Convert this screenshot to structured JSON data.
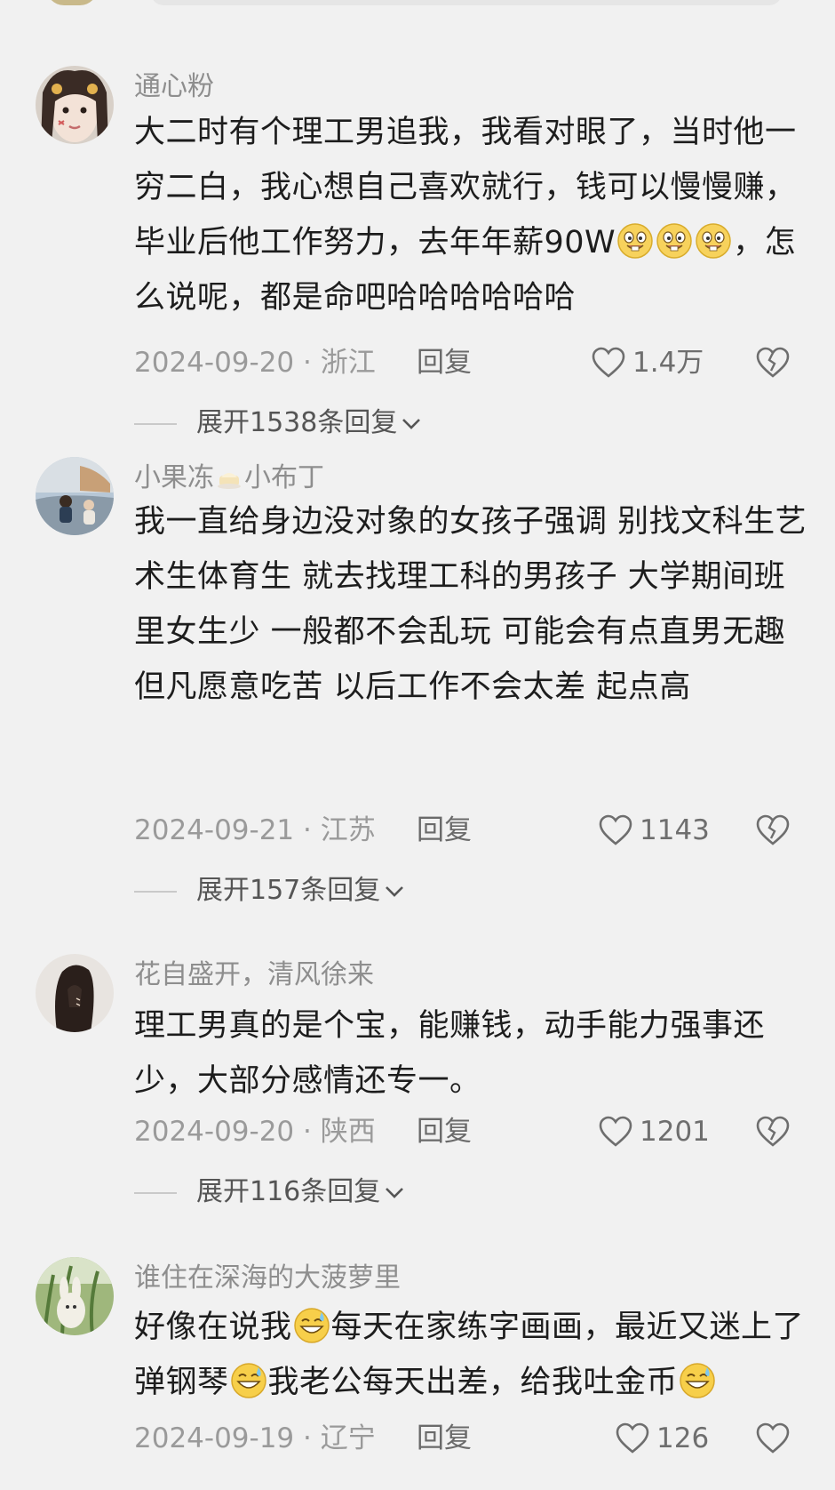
{
  "comments": [
    {
      "username": "通心粉",
      "content_parts": [
        "大二时有个理工男追我，我看对眼了，当时他一穷二白，我心想自己喜欢就行，钱可以慢慢赚，毕业后他工作努力，去年年薪90W",
        "，怎么说呢，都是命吧哈哈哈哈哈哈"
      ],
      "date_location": "2024-09-20 · 浙江",
      "reply_label": "回复",
      "likes": "1.4万",
      "expand_label": "展开1538条回复"
    },
    {
      "username_a": "小果冻",
      "username_b": "小布丁",
      "content": "我一直给身边没对象的女孩子强调 别找文科生艺术生体育生 就去找理工科的男孩子 大学期间班里女生少 一般都不会乱玩 可能会有点直男无趣 但凡愿意吃苦 以后工作不会太差 起点高",
      "date_location": "2024-09-21 · 江苏",
      "reply_label": "回复",
      "likes": "1143",
      "expand_label": "展开157条回复"
    },
    {
      "username": "花自盛开，清风徐来",
      "content": "理工男真的是个宝，能赚钱，动手能力强事还少，大部分感情还专一。",
      "date_location": "2024-09-20 · 陕西",
      "reply_label": "回复",
      "likes": "1201",
      "expand_label": "展开116条回复"
    },
    {
      "username": "谁住在深海的大菠萝里",
      "content_parts": [
        "好像在说我",
        "每天在家练字画画，最近又迷上了弹钢琴",
        "我老公每天出差，给我吐金币"
      ],
      "date_location": "2024-09-19 · 辽宁",
      "reply_label": "回复",
      "likes": "126"
    }
  ],
  "icons": {
    "like": "heart-outline-icon",
    "dislike": "broken-heart-icon",
    "expand": "chevron-down-icon",
    "emoji_a": "grinning-buck-teeth-emoji",
    "emoji_b": "sweat-smile-emoji"
  },
  "colors": {
    "background": "#f1f1f1",
    "username": "#8e8e8e",
    "meta": "#9a9a9a"
  }
}
